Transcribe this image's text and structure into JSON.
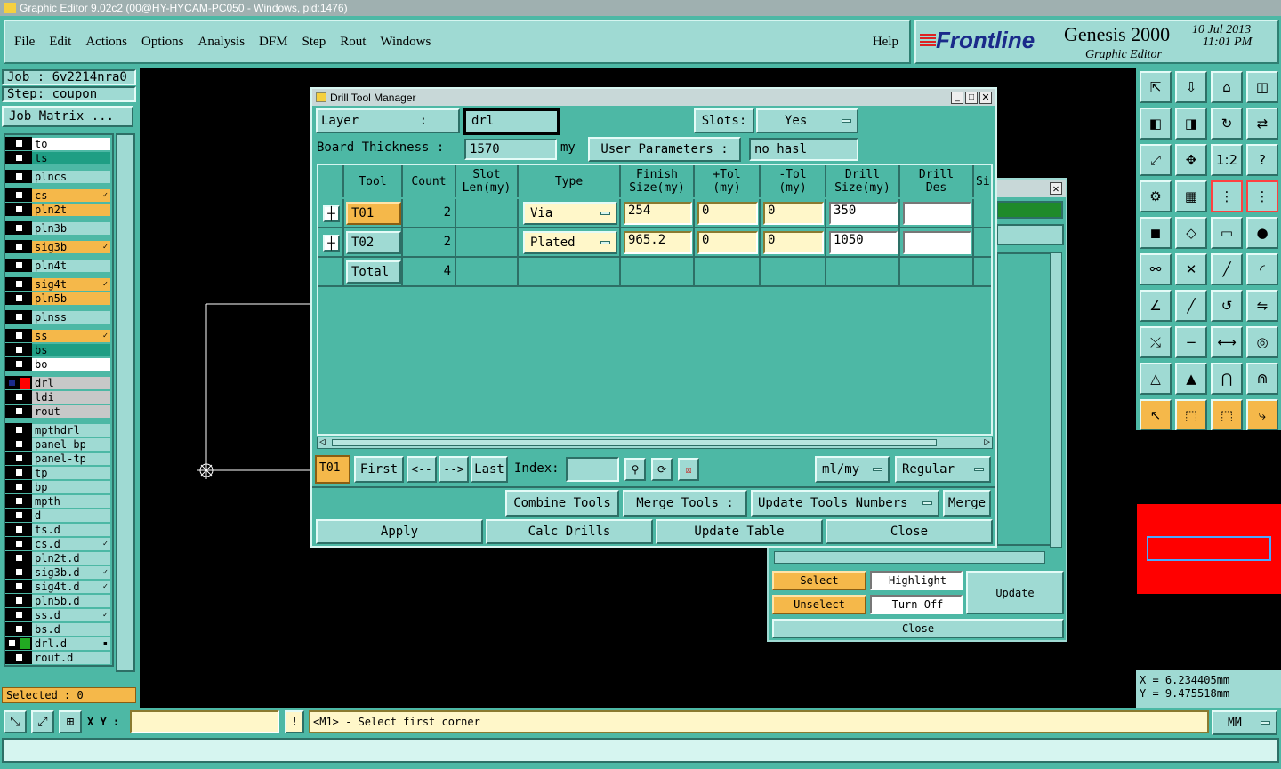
{
  "window": {
    "title": "Graphic Editor 9.02c2 (00@HY-HYCAM-PC050 - Windows, pid:1476)"
  },
  "menu": {
    "items": [
      "File",
      "Edit",
      "Actions",
      "Options",
      "Analysis",
      "DFM",
      "Step",
      "Rout",
      "Windows"
    ],
    "help": "Help"
  },
  "brand": {
    "logo": "Frontline",
    "product": "Genesis 2000",
    "subtitle": "Graphic Editor",
    "date": "10 Jul 2013",
    "time": "11:01 PM"
  },
  "job": {
    "job_label": "Job : 6v2214nra0",
    "step_label": "Step: coupon",
    "matrix_button": "Job Matrix ..."
  },
  "layers": [
    {
      "name": "to",
      "color": "#ffffff",
      "active": false
    },
    {
      "name": "ts",
      "color": "#1f9e84",
      "active": false
    },
    {
      "name": "plncs",
      "color": "#9fdad3",
      "active": false
    },
    {
      "name": "cs",
      "color": "#f5b84a",
      "active": false,
      "mark": "✓"
    },
    {
      "name": "pln2t",
      "color": "#f5b84a",
      "active": false
    },
    {
      "name": "pln3b",
      "color": "#9fdad3",
      "active": false
    },
    {
      "name": "sig3b",
      "color": "#f5b84a",
      "active": false,
      "mark": "✓"
    },
    {
      "name": "pln4t",
      "color": "#9fdad3",
      "active": false
    },
    {
      "name": "sig4t",
      "color": "#f5b84a",
      "active": false,
      "mark": "✓"
    },
    {
      "name": "pln5b",
      "color": "#f5b84a",
      "active": false
    },
    {
      "name": "plnss",
      "color": "#9fdad3",
      "active": false
    },
    {
      "name": "ss",
      "color": "#f5b84a",
      "active": false,
      "mark": "✓"
    },
    {
      "name": "bs",
      "color": "#1f9e84",
      "active": false
    },
    {
      "name": "bo",
      "color": "#ffffff",
      "active": false
    },
    {
      "name": "drl",
      "color": "#c8c8c8",
      "active": true,
      "swatch": "#ff0000"
    },
    {
      "name": "ldi",
      "color": "#c8c8c8",
      "active": false
    },
    {
      "name": "rout",
      "color": "#c8c8c8",
      "active": false
    },
    {
      "name": "mpthdrl",
      "color": "#9fdad3",
      "active": false
    },
    {
      "name": "panel-bp",
      "color": "#9fdad3",
      "active": false
    },
    {
      "name": "panel-tp",
      "color": "#9fdad3",
      "active": false
    },
    {
      "name": "tp",
      "color": "#9fdad3",
      "active": false
    },
    {
      "name": "bp",
      "color": "#9fdad3",
      "active": false
    },
    {
      "name": "mpth",
      "color": "#9fdad3",
      "active": false
    },
    {
      "name": "d",
      "color": "#9fdad3",
      "active": false
    },
    {
      "name": "ts.d",
      "color": "#9fdad3",
      "active": false
    },
    {
      "name": "cs.d",
      "color": "#9fdad3",
      "active": false,
      "mark": "✓"
    },
    {
      "name": "pln2t.d",
      "color": "#9fdad3",
      "active": false
    },
    {
      "name": "sig3b.d",
      "color": "#9fdad3",
      "active": false,
      "mark": "✓"
    },
    {
      "name": "sig4t.d",
      "color": "#9fdad3",
      "active": false,
      "mark": "✓"
    },
    {
      "name": "pln5b.d",
      "color": "#9fdad3",
      "active": false
    },
    {
      "name": "ss.d",
      "color": "#9fdad3",
      "active": false,
      "mark": "✓"
    },
    {
      "name": "bs.d",
      "color": "#9fdad3",
      "active": false
    },
    {
      "name": "drl.d",
      "color": "#9fdad3",
      "active": false,
      "swatch": "#22aa22",
      "mark": "▪"
    },
    {
      "name": "rout.d",
      "color": "#9fdad3",
      "active": false
    }
  ],
  "selected_label": "Selected : 0",
  "dialog": {
    "title": "Drill Tool Manager",
    "layer_label": "Layer :",
    "layer_value": "drl",
    "slots_label": "Slots:",
    "slots_value": "Yes",
    "thickness_label": "Board Thickness :",
    "thickness_value": "1570",
    "thickness_unit": "my",
    "user_params_label": "User Parameters :",
    "user_params_value": "no_hasl",
    "columns": [
      "Tool",
      "Count",
      "Slot\nLen(my)",
      "Type",
      "Finish\nSize(my)",
      "+Tol\n(my)",
      "-Tol\n(my)",
      "Drill\nSize(my)",
      "Drill\nDes",
      "Si"
    ],
    "rows": [
      {
        "tool": "T01",
        "count": "2",
        "type": "Via",
        "finish": "254",
        "ptol": "0",
        "mtol": "0",
        "drill": "350",
        "des": ""
      },
      {
        "tool": "T02",
        "count": "2",
        "type": "Plated",
        "finish": "965.2",
        "ptol": "0",
        "mtol": "0",
        "drill": "1050",
        "des": ""
      }
    ],
    "total_label": "Total",
    "total_count": "4",
    "nav": {
      "current": "T01",
      "first": "First",
      "prev": "<--",
      "next": "-->",
      "last": "Last",
      "index_label": "Index:",
      "units": "ml/my",
      "mode": "Regular"
    },
    "combine_tools": "Combine Tools",
    "merge_tools_label": "Merge Tools :",
    "update_numbers": "Update Tools Numbers",
    "merge": "Merge",
    "apply": "Apply",
    "calc_drills": "Calc Drills",
    "update_table": "Update Table",
    "close": "Close"
  },
  "sub_dialog": {
    "select": "Select",
    "highlight": "Highlight",
    "update": "Update",
    "unselect": "Unselect",
    "turn_off": "Turn Off",
    "close": "Close"
  },
  "coords": {
    "x": "X = 6.234405mm",
    "y": "Y = 9.475518mm"
  },
  "statusbar": {
    "xy_label": "X Y :",
    "xy_value": "",
    "prompt": "<M1> - Select first corner",
    "units": "MM"
  },
  "colors": {
    "teal": "#4db8a5",
    "light": "#9fdad3",
    "orange": "#f5b84a",
    "red": "#ff0000"
  }
}
